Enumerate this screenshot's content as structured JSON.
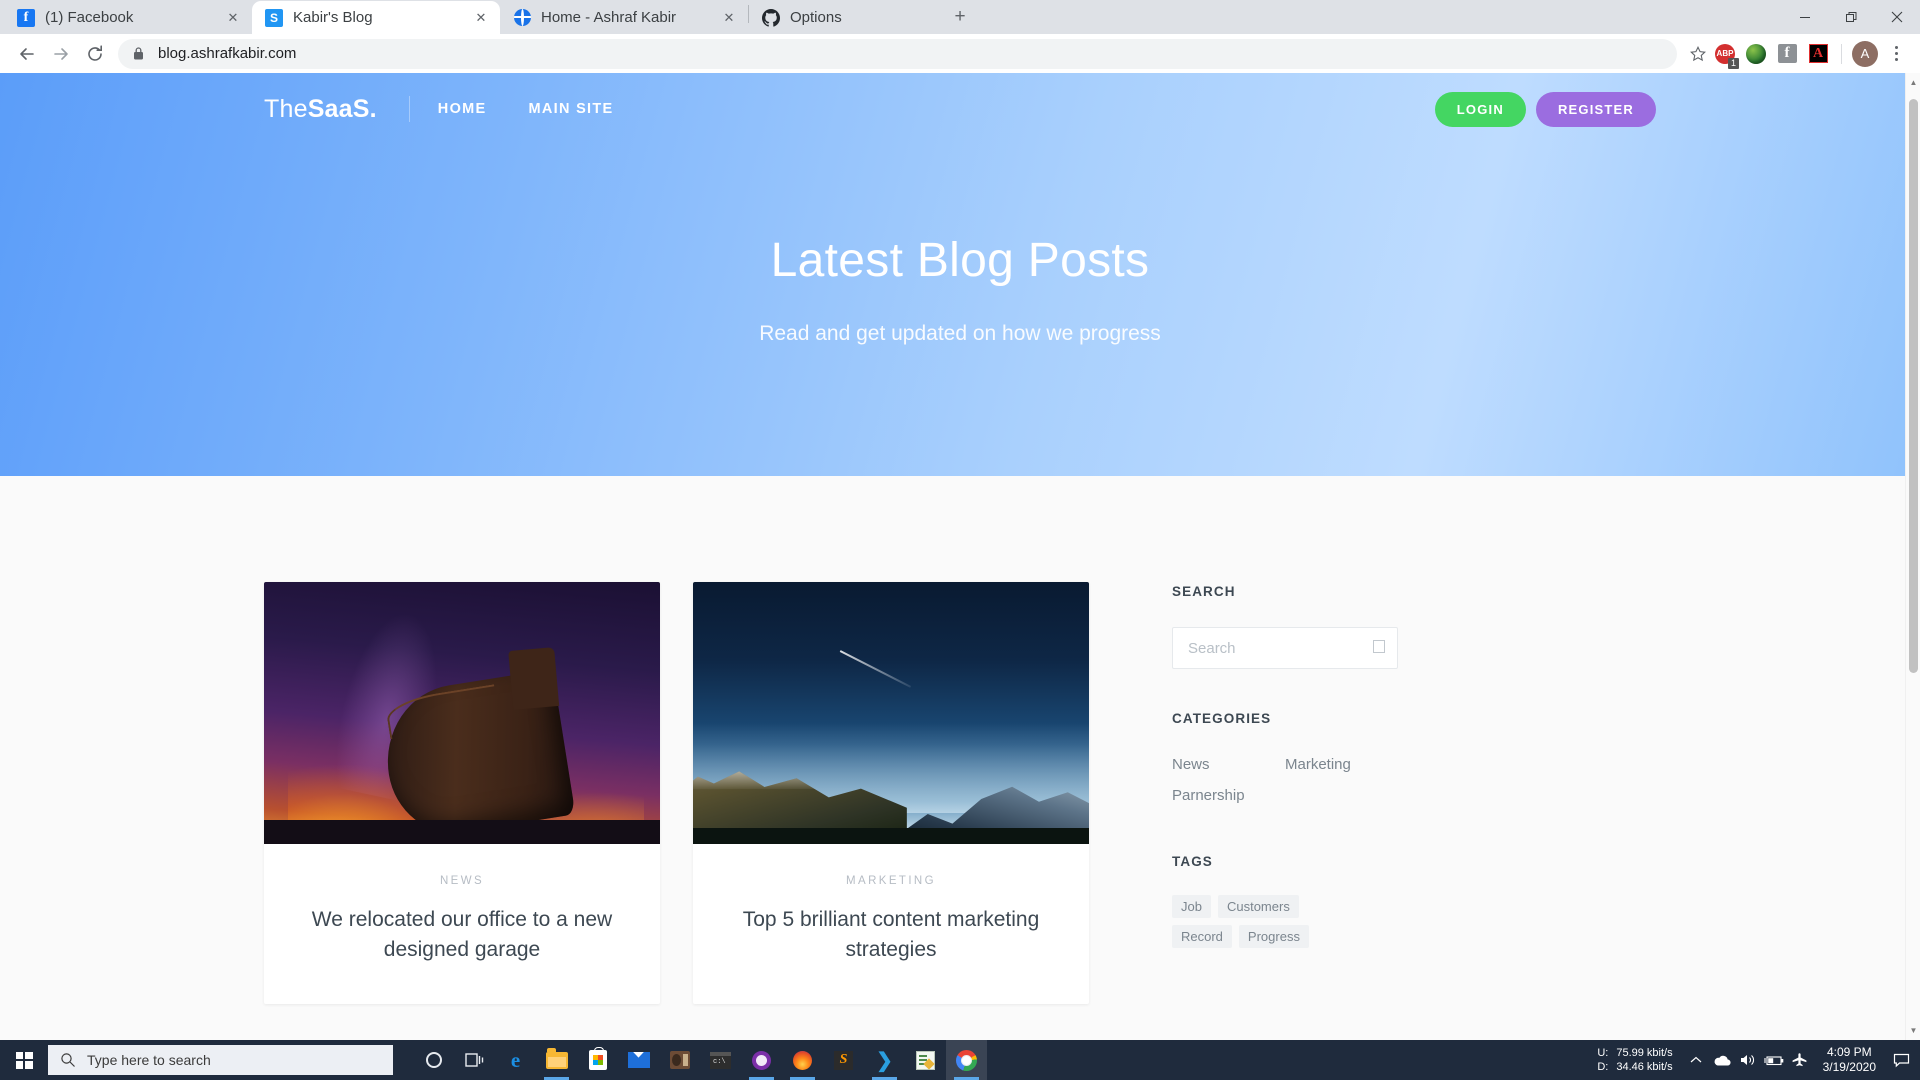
{
  "browser": {
    "tabs": [
      {
        "title": "(1) Facebook",
        "favicon": "facebook-icon",
        "active": false,
        "has_close": true
      },
      {
        "title": "Kabir's Blog",
        "favicon": "sublime-icon",
        "active": true,
        "has_close": true
      },
      {
        "title": "Home - Ashraf Kabir",
        "favicon": "globe-icon",
        "active": false,
        "has_close": true
      },
      {
        "title": "Options",
        "favicon": "github-icon",
        "active": false,
        "has_close": false
      }
    ],
    "new_tab_label": "+",
    "window_controls": {
      "minimize": "—",
      "restore": "❐",
      "close": "✕"
    },
    "nav": {
      "back": "←",
      "forward": "→",
      "reload": "⟳"
    },
    "omnibox": {
      "url": "blog.ashrafkabir.com",
      "lock_icon": "lock-icon",
      "star_icon": "star-icon"
    },
    "extensions": [
      {
        "name": "adblock-plus-icon",
        "label": "ABP",
        "badge": "1"
      },
      {
        "name": "internet-download-manager-icon",
        "label": ""
      },
      {
        "name": "facebook-extension-icon",
        "label": "f"
      },
      {
        "name": "adobe-acrobat-icon",
        "label": "A"
      }
    ],
    "profile_initial": "A",
    "menu_icon": "kebab-menu-icon"
  },
  "site": {
    "logo": {
      "light": "The",
      "bold": "SaaS."
    },
    "nav_links": [
      {
        "label": "HOME"
      },
      {
        "label": "MAIN SITE"
      }
    ],
    "buttons": {
      "login": "LOGIN",
      "register": "REGISTER"
    },
    "hero": {
      "title": "Latest Blog Posts",
      "subtitle": "Read and get updated on how we progress"
    },
    "posts": [
      {
        "category": "NEWS",
        "title": "We relocated our office to a new designed garage",
        "image": "night-sky-wooden-boat-photo"
      },
      {
        "category": "MARKETING",
        "title": "Top 5 brilliant content marketing strategies",
        "image": "starry-night-snowy-mountains-photo"
      }
    ],
    "sidebar": {
      "search": {
        "heading": "SEARCH",
        "placeholder": "Search",
        "value": "",
        "icon": "search-icon"
      },
      "categories": {
        "heading": "CATEGORIES",
        "items": [
          "News",
          "Marketing",
          "Parnership"
        ]
      },
      "tags": {
        "heading": "TAGS",
        "items": [
          "Job",
          "Customers",
          "Record",
          "Progress"
        ]
      }
    },
    "colors": {
      "login_green": "#44d662",
      "register_purple": "#9b6de0",
      "hero_blue": "#7db4fb"
    }
  },
  "taskbar": {
    "start_icon": "windows-start-icon",
    "search_placeholder": "Type here to search",
    "search_icon": "magnifier-icon",
    "apps": [
      {
        "name": "cortana-icon"
      },
      {
        "name": "task-view-icon"
      },
      {
        "name": "microsoft-edge-icon"
      },
      {
        "name": "file-explorer-icon",
        "running": true
      },
      {
        "name": "microsoft-store-icon"
      },
      {
        "name": "mail-icon"
      },
      {
        "name": "radio-app-icon"
      },
      {
        "name": "command-prompt-icon"
      },
      {
        "name": "purple-app-icon",
        "running": true
      },
      {
        "name": "firefox-icon",
        "running": true
      },
      {
        "name": "sublime-text-icon"
      },
      {
        "name": "visual-studio-code-icon",
        "running": true
      },
      {
        "name": "text-editor-icon"
      },
      {
        "name": "google-chrome-icon",
        "running": true,
        "active": true
      }
    ],
    "network": {
      "up_label": "U:",
      "up_value": "75.99 kbit/s",
      "down_label": "D:",
      "down_value": "34.46 kbit/s"
    },
    "tray_icons": [
      "chevron-up-icon",
      "onedrive-icon",
      "volume-icon",
      "battery-icon",
      "airplane-mode-icon"
    ],
    "clock": {
      "time": "4:09 PM",
      "date": "3/19/2020"
    },
    "notification_icon": "notification-icon"
  }
}
